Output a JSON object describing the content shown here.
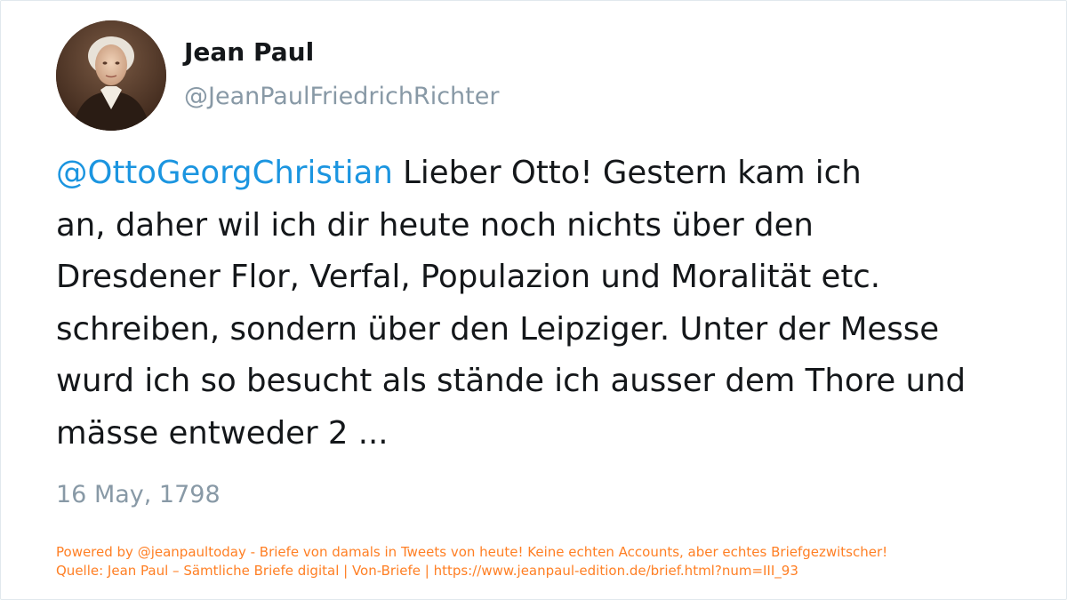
{
  "user": {
    "display_name": "Jean Paul",
    "handle": "@JeanPaulFriedrichRichter"
  },
  "tweet": {
    "mention": "@OttoGeorgChristian",
    "lines": [
      " Lieber Otto! Gestern kam ich",
      "an, daher wil ich dir heute noch nichts über den",
      "Dresdener Flor, Verfal, Populazion und Moralität etc.",
      "schreiben, sondern über den Leipziger. Unter der Messe",
      "wurd ich so besucht als stände ich ausser dem Thore und",
      "mässe entweder 2 ..."
    ],
    "date": "16 May, 1798"
  },
  "footer": {
    "line1": "Powered by @jeanpaultoday - Briefe von damals in Tweets von heute! Keine echten Accounts, aber echtes Briefgezwitscher!",
    "line2": "Quelle: Jean Paul – Sämtliche Briefe digital | Von-Briefe | https://www.jeanpaul-edition.de/brief.html?num=III_93"
  },
  "colors": {
    "mention": "#1b95e0",
    "text": "#14171a",
    "muted": "#8899a6",
    "footer": "#ff7f24"
  }
}
